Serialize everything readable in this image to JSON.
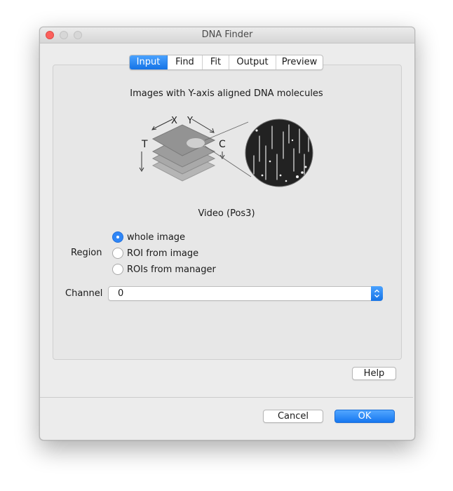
{
  "window": {
    "title": "DNA Finder"
  },
  "tabs": [
    {
      "label": "Input",
      "active": true
    },
    {
      "label": "Find",
      "active": false
    },
    {
      "label": "Fit",
      "active": false
    },
    {
      "label": "Output",
      "active": false
    },
    {
      "label": "Preview",
      "active": false
    }
  ],
  "input": {
    "heading": "Images with Y-axis aligned DNA molecules",
    "diagram": {
      "x_label": "X",
      "y_label": "Y",
      "t_label": "T",
      "c_label": "C"
    },
    "video_label": "Video (Pos3)",
    "region": {
      "label": "Region",
      "options": [
        {
          "label": "whole image",
          "selected": true
        },
        {
          "label": "ROI from image",
          "selected": false
        },
        {
          "label": "ROIs from manager",
          "selected": false
        }
      ]
    },
    "channel": {
      "label": "Channel",
      "value": "0"
    }
  },
  "buttons": {
    "help": "Help",
    "cancel": "Cancel",
    "ok": "OK"
  },
  "colors": {
    "accent": "#1473e6",
    "close_button": "#fc605c"
  }
}
